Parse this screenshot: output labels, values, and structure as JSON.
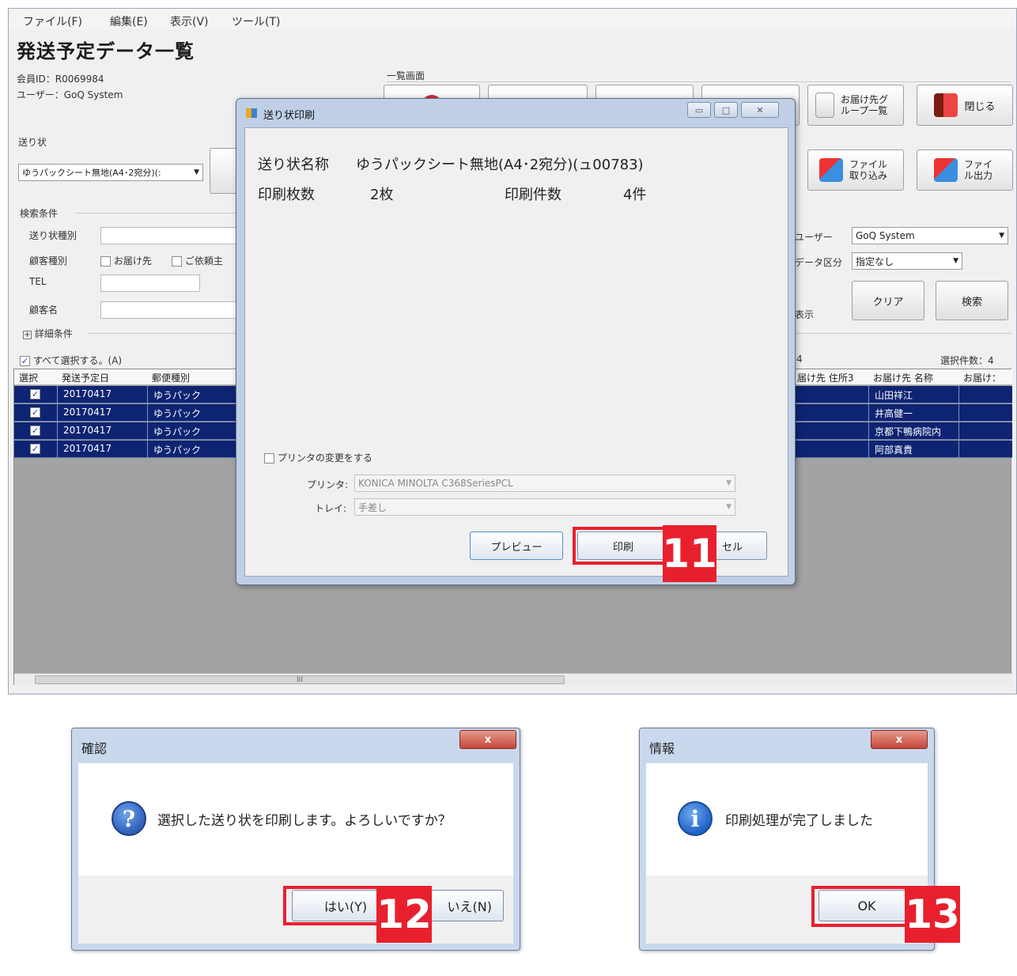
{
  "menubar": {
    "items": [
      "ファイル(F)",
      "編集(E)",
      "表示(V)",
      "ツール(T)"
    ]
  },
  "main": {
    "title": "発送予定データ一覧",
    "member_id": "会員ID：R0069984",
    "user": "ユーザー：GoQ System",
    "list_screen_label": "一覧画面",
    "toolbar": {
      "group_list_button": "お届け先グループ一覧",
      "close_button": "閉じる",
      "file_import_button": "ファイル取り込み",
      "file_export_button": "ファイル出力"
    },
    "invoice_section_label": "送り状",
    "invoice_select_value": "ゆうパックシート無地(A4･2宛分)(:",
    "search": {
      "section_label": "検索条件",
      "invoice_type_label": "送り状種別",
      "customer_type_label": "顧客種別",
      "customer_type_option1": "お届け先",
      "customer_type_option2": "ご依頼主",
      "tel_label": "TEL",
      "customer_name_label": "顧客名",
      "user_label": "ユーザー",
      "user_value": "GoQ System",
      "data_category_label": "データ区分",
      "data_category_value": "指定なし",
      "display_label": "表示",
      "clear_button": "クリア",
      "search_button": "検索",
      "detail_conditions_label": "詳細条件"
    },
    "select_all_label": "すべて選択する。(A)",
    "count_fragment": "4",
    "selected_count": "選択件数：4",
    "table": {
      "headers": [
        "選択",
        "発送予定日",
        "郵便種別",
        "届け先 住所3",
        "お届け先 名称",
        "お届け："
      ],
      "rows": [
        {
          "date": "20170417",
          "type": "ゆうパック",
          "name": "山田祥江"
        },
        {
          "date": "20170417",
          "type": "ゆうパック",
          "name": "井高健一"
        },
        {
          "date": "20170417",
          "type": "ゆうパック",
          "name": "京都下鴨病院内"
        },
        {
          "date": "20170417",
          "type": "ゆうパック",
          "name": "阿部真貴"
        }
      ],
      "scroll_grip": "III"
    }
  },
  "print_dialog": {
    "title": "送り状印刷",
    "name_label": "送り状名称",
    "name_value": "ゆうパックシート無地(A4･2宛分)(ュ00783)",
    "copies_label": "印刷枚数",
    "copies_value": "2枚",
    "count_label": "印刷件数",
    "count_value": "4件",
    "change_printer_label": "プリンタの変更をする",
    "printer_label": "プリンタ:",
    "printer_value": "KONICA MINOLTA C368SeriesPCL",
    "tray_label": "トレイ:",
    "tray_value": "手差し",
    "preview_button": "プレビュー",
    "print_button": "印刷",
    "cancel_button_fragment": "セル"
  },
  "confirm_dialog": {
    "title": "確認",
    "message": "選択した送り状を印刷します。よろしいですか？",
    "yes_button": "はい(Y)",
    "no_button": "いいえ(N)",
    "no_button_visible": "いえ(N)",
    "close_glyph": "x"
  },
  "info_dialog": {
    "title": "情報",
    "message": "印刷処理が完了しました",
    "ok_button": "OK",
    "close_glyph": "x"
  },
  "step_markers": [
    "11",
    "12",
    "13"
  ],
  "icons": {
    "question": "?",
    "info": "i"
  },
  "colors": {
    "marker_red": "#e8202e",
    "selection_blue": "#0e2472",
    "question_icon": "#2d5fb8",
    "info_icon": "#1f63c6"
  }
}
